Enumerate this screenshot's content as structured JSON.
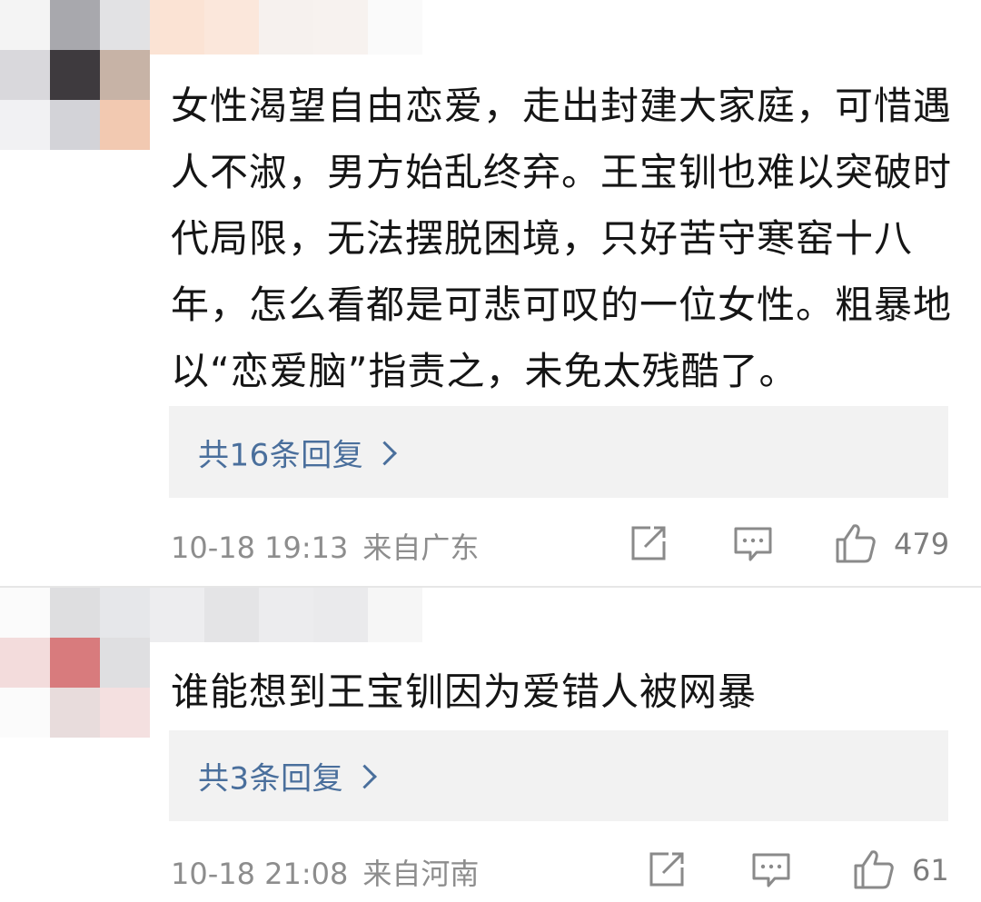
{
  "comments": [
    {
      "text": "女性渴望自由恋爱，走出封建大家庭，可惜遇人不淑，男方始乱终弃。王宝钏也难以突破时代局限，无法摆脱困境，只好苦守寒窑十八年，怎么看都是可悲可叹的一位女性。粗暴地以“恋爱脑”指责之，未免太残酷了。",
      "reply_label": "共16条回复",
      "timestamp": "10-18 19:13",
      "location": "来自广东",
      "like_count": "479"
    },
    {
      "text": "谁能想到王宝钏因为爱错人被网暴",
      "reply_label": "共3条回复",
      "timestamp": "10-18 21:08",
      "location": "来自河南",
      "like_count": "61"
    }
  ],
  "icons": {
    "share": "share-icon",
    "comment": "comment-icon",
    "like": "thumbs-up-icon"
  },
  "colors": {
    "reply_link": "#4a6f9c",
    "reply_box_bg": "#f2f2f2",
    "meta_text": "#8d8d8d",
    "divider": "#e6e6e6"
  }
}
